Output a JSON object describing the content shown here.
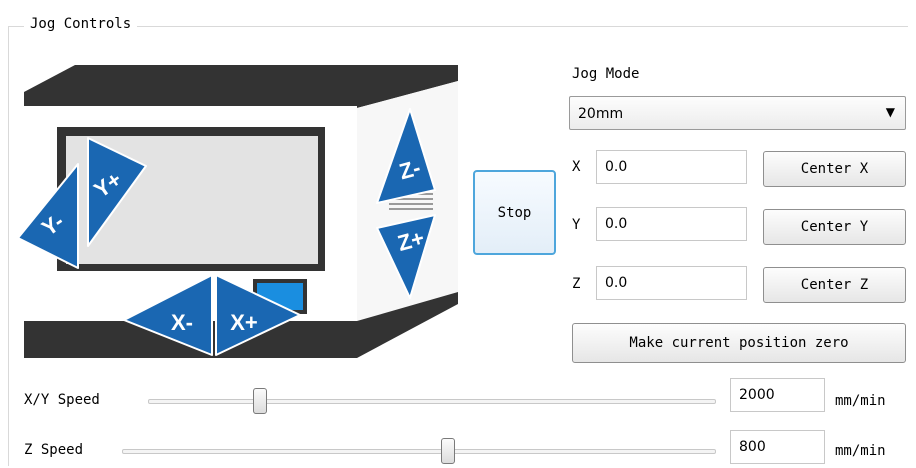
{
  "group": {
    "title": "Jog Controls"
  },
  "machine": {
    "y_minus": "Y-",
    "y_plus": "Y+",
    "x_minus": "X-",
    "x_plus": "X+",
    "z_minus": "Z-",
    "z_plus": "Z+",
    "accent_color": "#1a67b2",
    "screen_color": "#e3e3e3",
    "indicator_color": "#1a8ee0"
  },
  "stop_label": "Stop",
  "jog_mode": {
    "label": "Jog Mode",
    "selected": "20mm"
  },
  "axes": [
    {
      "label": "X",
      "value": "0.0",
      "button": "Center X"
    },
    {
      "label": "Y",
      "value": "0.0",
      "button": "Center Y"
    },
    {
      "label": "Z",
      "value": "0.0",
      "button": "Center Z"
    }
  ],
  "zero_button": "Make current position zero",
  "xy_speed": {
    "label": "X/Y Speed",
    "value": "2000",
    "unit": "mm/min",
    "slider_fraction": 0.19
  },
  "z_speed": {
    "label": "Z Speed",
    "value": "800",
    "unit": "mm/min",
    "slider_fraction": 0.55
  }
}
